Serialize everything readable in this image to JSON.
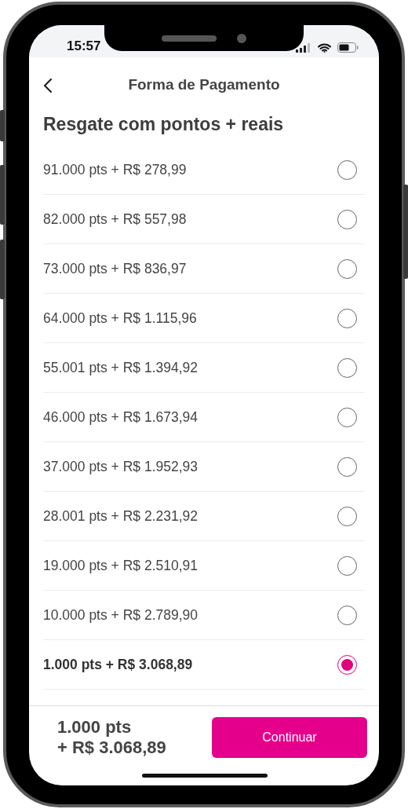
{
  "status_bar": {
    "time": "15:57"
  },
  "header": {
    "title": "Forma de Pagamento"
  },
  "section_title": "Resgate com pontos + reais",
  "options": [
    {
      "label": "91.000 pts + R$ 278,99",
      "selected": false
    },
    {
      "label": "82.000 pts + R$ 557,98",
      "selected": false
    },
    {
      "label": "73.000 pts + R$ 836,97",
      "selected": false
    },
    {
      "label": "64.000 pts + R$ 1.115,96",
      "selected": false
    },
    {
      "label": "55.001 pts + R$ 1.394,92",
      "selected": false
    },
    {
      "label": "46.000 pts + R$ 1.673,94",
      "selected": false
    },
    {
      "label": "37.000 pts + R$ 1.952,93",
      "selected": false
    },
    {
      "label": "28.001 pts + R$ 2.231,92",
      "selected": false
    },
    {
      "label": "19.000 pts + R$ 2.510,91",
      "selected": false
    },
    {
      "label": "10.000 pts + R$ 2.789,90",
      "selected": false
    },
    {
      "label": "1.000 pts + R$ 3.068,89",
      "selected": true
    }
  ],
  "footer": {
    "points": "1.000 pts",
    "amount": "+ R$ 3.068,89",
    "button": "Continuar"
  }
}
